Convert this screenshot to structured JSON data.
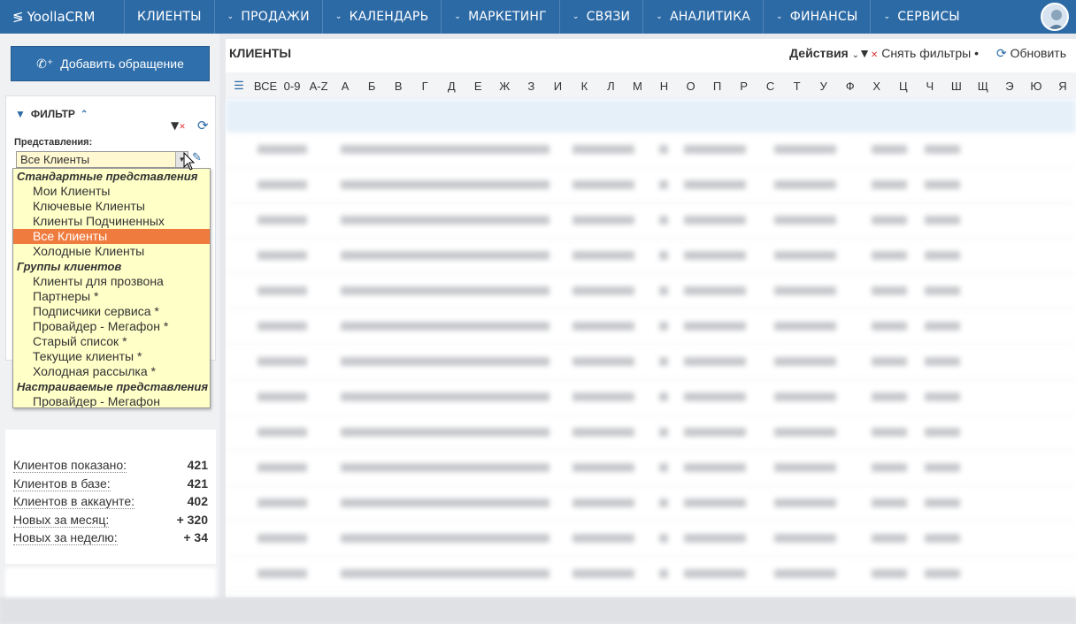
{
  "app": {
    "title": "YoollaCRM"
  },
  "nav": {
    "items": [
      {
        "label": "КЛИЕНТЫ"
      },
      {
        "label": "ПРОДАЖИ"
      },
      {
        "label": "КАЛЕНДАРЬ"
      },
      {
        "label": "МАРКЕТИНГ"
      },
      {
        "label": "СВЯЗИ"
      },
      {
        "label": "АНАЛИТИКА"
      },
      {
        "label": "ФИНАНСЫ"
      },
      {
        "label": "СЕРВИСЫ"
      }
    ]
  },
  "sidebar": {
    "add_button": "Добавить обращение",
    "filter": {
      "title": "ФИЛЬТР",
      "views_label": "Представления:",
      "selected_view": "Все Клиенты",
      "dropdown": [
        {
          "type": "group",
          "label": "Стандартные представления"
        },
        {
          "type": "option",
          "label": "Мои Клиенты"
        },
        {
          "type": "option",
          "label": "Ключевые Клиенты"
        },
        {
          "type": "option",
          "label": "Клиенты Подчиненных"
        },
        {
          "type": "option",
          "label": "Все Клиенты",
          "selected": true
        },
        {
          "type": "option",
          "label": "Холодные Клиенты"
        },
        {
          "type": "group",
          "label": "Группы клиентов"
        },
        {
          "type": "option",
          "label": "Клиенты для прозвона"
        },
        {
          "type": "option",
          "label": "Партнеры *"
        },
        {
          "type": "option",
          "label": "Подписчики сервиса *"
        },
        {
          "type": "option",
          "label": "Провайдер - Мегафон *"
        },
        {
          "type": "option",
          "label": "Старый список *"
        },
        {
          "type": "option",
          "label": "Текущие клиенты *"
        },
        {
          "type": "option",
          "label": "Холодная рассылка *"
        },
        {
          "type": "group",
          "label": "Настраиваемые представления"
        },
        {
          "type": "option",
          "label": "Провайдер - Мегафон"
        }
      ]
    },
    "stats": {
      "rows": [
        {
          "label": "Клиентов показано:",
          "value": "421"
        },
        {
          "label": "Клиентов в базе:",
          "value": "421"
        },
        {
          "label": "Клиентов в аккаунте:",
          "value": "402"
        },
        {
          "label": "Новых за месяц:",
          "value": "+ 320"
        },
        {
          "label": "Новых за неделю:",
          "value": "+ 34"
        }
      ]
    }
  },
  "main": {
    "title": "КЛИЕНТЫ",
    "actions_label": "Действия",
    "clear_filters_label": "Снять фильтры",
    "refresh_label": "Обновить",
    "alphabet": [
      "ВСЕ",
      "0-9",
      "A-Z",
      "А",
      "Б",
      "В",
      "Г",
      "Д",
      "Е",
      "Ж",
      "З",
      "И",
      "К",
      "Л",
      "М",
      "Н",
      "О",
      "П",
      "Р",
      "С",
      "Т",
      "У",
      "Ф",
      "Х",
      "Ц",
      "Ч",
      "Ш",
      "Щ",
      "Э",
      "Ю",
      "Я"
    ]
  },
  "colors": {
    "nav_bg": "#2c6aa6",
    "accent": "#2f6fab",
    "selected_option": "#f07b3f",
    "dropdown_bg": "#ffffc8"
  }
}
